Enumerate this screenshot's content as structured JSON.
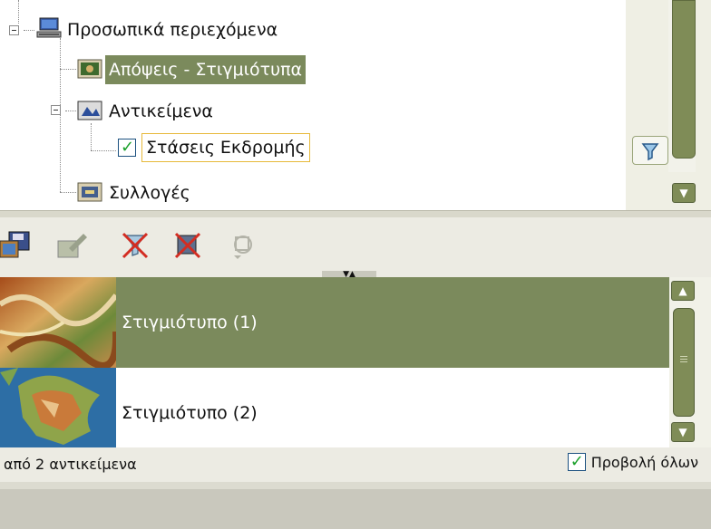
{
  "tree": {
    "items": [
      {
        "label": "Προσωπικά περιεχόμενα",
        "icon": "computer-icon"
      },
      {
        "label": "Απόψεις - Στιγμιότυπα",
        "icon": "folder-views-icon"
      },
      {
        "label": "Αντικείμενα",
        "icon": "folder-objects-icon"
      },
      {
        "label": "Στάσεις Εκδρομής",
        "icon": "checkbox-icon",
        "checked": true
      },
      {
        "label": "Συλλογές",
        "icon": "folder-collections-icon"
      }
    ]
  },
  "list": {
    "items": [
      {
        "label": "Στιγμιότυπο (1)",
        "selected": true
      },
      {
        "label": "Στιγμιότυπο (2)",
        "selected": false
      }
    ]
  },
  "status": {
    "count_text": "από 2 αντικείμενα",
    "show_all_label": "Προβολή όλων",
    "show_all_checked": true
  },
  "colors": {
    "selection": "#7b8a5c",
    "scrollbar": "#7f8c57",
    "focus_border": "#e7b93a"
  }
}
